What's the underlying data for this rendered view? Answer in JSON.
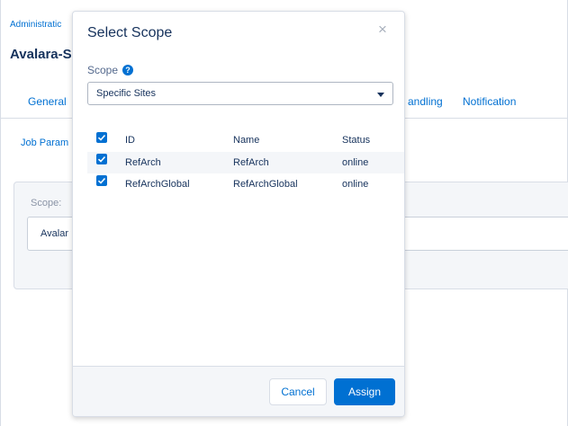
{
  "background": {
    "breadcrumb": "Administratic",
    "title": "Avalara-S",
    "tabs": [
      "General",
      "andling",
      "Notification"
    ],
    "sublink": "Job Param",
    "panel_label": "Scope:",
    "panel_value": "Avalar"
  },
  "modal": {
    "title": "Select Scope",
    "close_glyph": "×",
    "scope_label": "Scope",
    "help_glyph": "?",
    "scope_selected": "Specific Sites",
    "table": {
      "columns": [
        "ID",
        "Name",
        "Status"
      ],
      "rows": [
        {
          "id": "RefArch",
          "name": "RefArch",
          "status": "online",
          "checked": true
        },
        {
          "id": "RefArchGlobal",
          "name": "RefArchGlobal",
          "status": "online",
          "checked": true
        }
      ]
    },
    "cancel_label": "Cancel",
    "assign_label": "Assign"
  },
  "colors": {
    "brand": "#0070d2",
    "text": "#16325c",
    "footer_bg": "#f4f6f9"
  },
  "icons": [
    "help-icon",
    "close-icon",
    "chevron-down-icon",
    "checkbox-checked-icon"
  ]
}
